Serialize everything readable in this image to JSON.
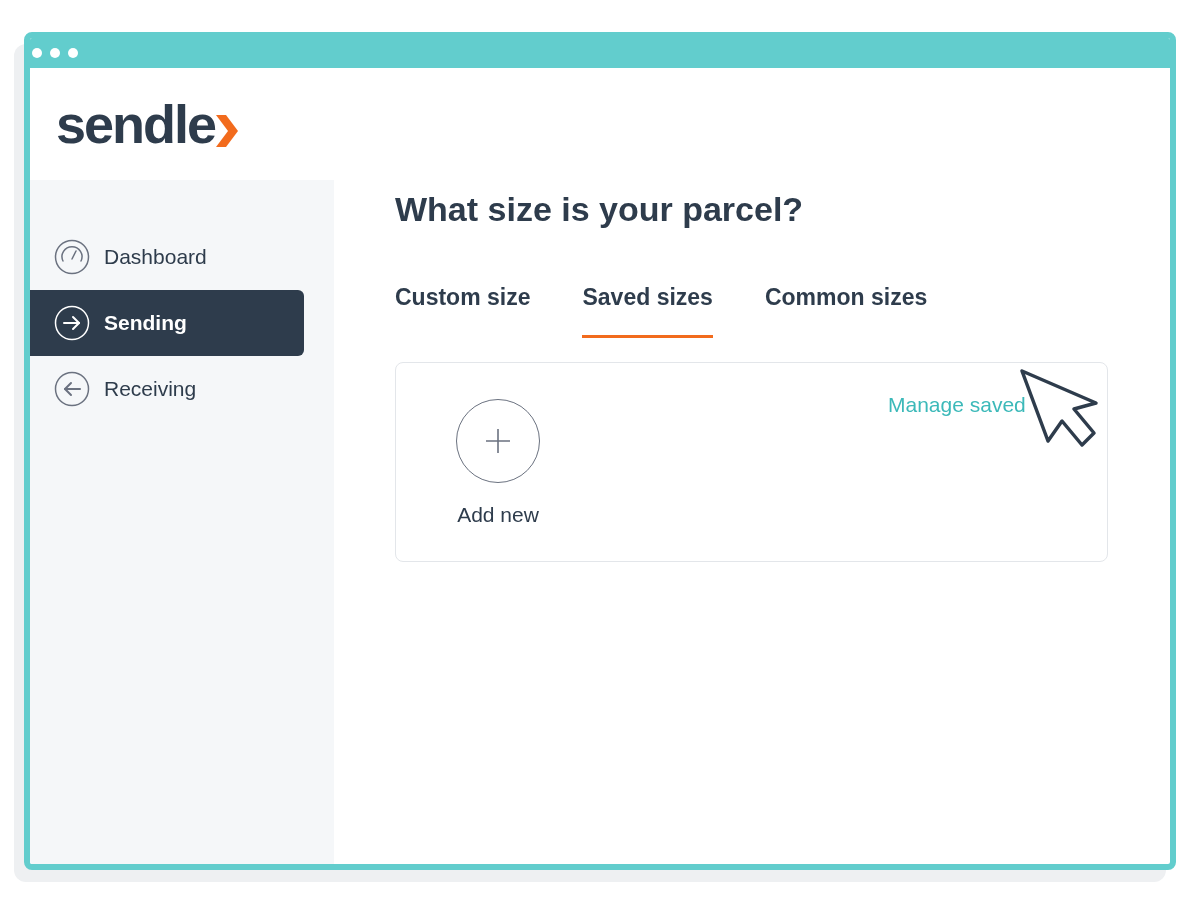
{
  "logo": {
    "text": "sendle"
  },
  "sidebar": {
    "items": [
      {
        "label": "Dashboard",
        "selected": false
      },
      {
        "label": "Sending",
        "selected": true
      },
      {
        "label": "Receiving",
        "selected": false
      }
    ]
  },
  "heading": "What size is your parcel?",
  "tabs": [
    {
      "label": "Custom size",
      "selected": false
    },
    {
      "label": "Saved sizes",
      "selected": true
    },
    {
      "label": "Common sizes",
      "selected": false
    }
  ],
  "card": {
    "add_label": "Add new",
    "link": "Manage saved"
  }
}
